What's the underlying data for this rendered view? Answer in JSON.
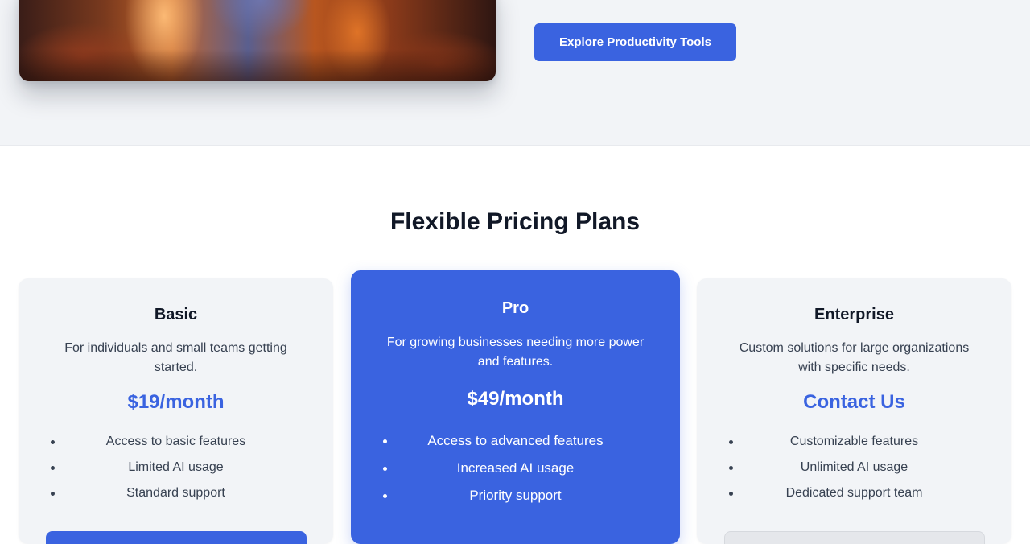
{
  "hero": {
    "cta_label": "Explore Productivity Tools"
  },
  "pricing": {
    "title": "Flexible Pricing Plans",
    "plans": [
      {
        "name": "Basic",
        "description": "For individuals and small teams getting started.",
        "price": "$19/month",
        "features": [
          "Access to basic features",
          "Limited AI usage",
          "Standard support"
        ]
      },
      {
        "name": "Pro",
        "description": "For growing businesses needing more power and features.",
        "price": "$49/month",
        "features": [
          "Access to advanced features",
          "Increased AI usage",
          "Priority support"
        ]
      },
      {
        "name": "Enterprise",
        "description": "Custom solutions for large organizations with specific needs.",
        "price": "Contact Us",
        "features": [
          "Customizable features",
          "Unlimited AI usage",
          "Dedicated support team"
        ]
      }
    ]
  },
  "colors": {
    "accent": "#3a63e0",
    "section_gray": "#f2f4f7",
    "heading": "#111827",
    "body_text": "#374151"
  }
}
